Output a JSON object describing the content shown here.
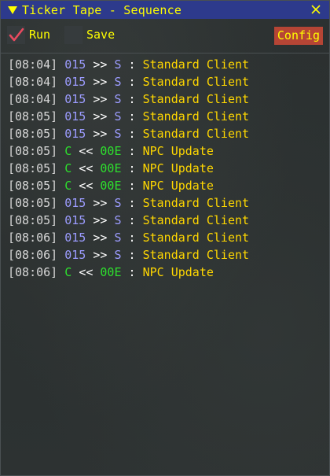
{
  "window": {
    "title": "Ticker Tape - Sequence",
    "close_icon": "x"
  },
  "toolbar": {
    "run_label": "Run",
    "run_checked": true,
    "save_label": "Save",
    "save_checked": false,
    "config_label": "Config"
  },
  "log": [
    {
      "time": "[08:04]",
      "src": "015",
      "dir": ">>",
      "dst": "S",
      "msg": "Standard Client"
    },
    {
      "time": "[08:04]",
      "src": "015",
      "dir": ">>",
      "dst": "S",
      "msg": "Standard Client"
    },
    {
      "time": "[08:04]",
      "src": "015",
      "dir": ">>",
      "dst": "S",
      "msg": "Standard Client"
    },
    {
      "time": "[08:05]",
      "src": "015",
      "dir": ">>",
      "dst": "S",
      "msg": "Standard Client"
    },
    {
      "time": "[08:05]",
      "src": "015",
      "dir": ">>",
      "dst": "S",
      "msg": "Standard Client"
    },
    {
      "time": "[08:05]",
      "src": "C",
      "dir": "<<",
      "dst": "00E",
      "msg": "NPC Update"
    },
    {
      "time": "[08:05]",
      "src": "C",
      "dir": "<<",
      "dst": "00E",
      "msg": "NPC Update"
    },
    {
      "time": "[08:05]",
      "src": "C",
      "dir": "<<",
      "dst": "00E",
      "msg": "NPC Update"
    },
    {
      "time": "[08:05]",
      "src": "015",
      "dir": ">>",
      "dst": "S",
      "msg": "Standard Client"
    },
    {
      "time": "[08:05]",
      "src": "015",
      "dir": ">>",
      "dst": "S",
      "msg": "Standard Client"
    },
    {
      "time": "[08:06]",
      "src": "015",
      "dir": ">>",
      "dst": "S",
      "msg": "Standard Client"
    },
    {
      "time": "[08:06]",
      "src": "015",
      "dir": ">>",
      "dst": "S",
      "msg": "Standard Client"
    },
    {
      "time": "[08:06]",
      "src": "C",
      "dir": "<<",
      "dst": "00E",
      "msg": "NPC Update"
    }
  ],
  "colors": {
    "title_bg": "#2d3a8c",
    "accent_yellow": "#ffff00",
    "config_bg": "#b64535",
    "client_id": "#9c9cff",
    "npc_id": "#2de02d",
    "message": "#ffd700",
    "check_mark": "#e84a5f"
  }
}
